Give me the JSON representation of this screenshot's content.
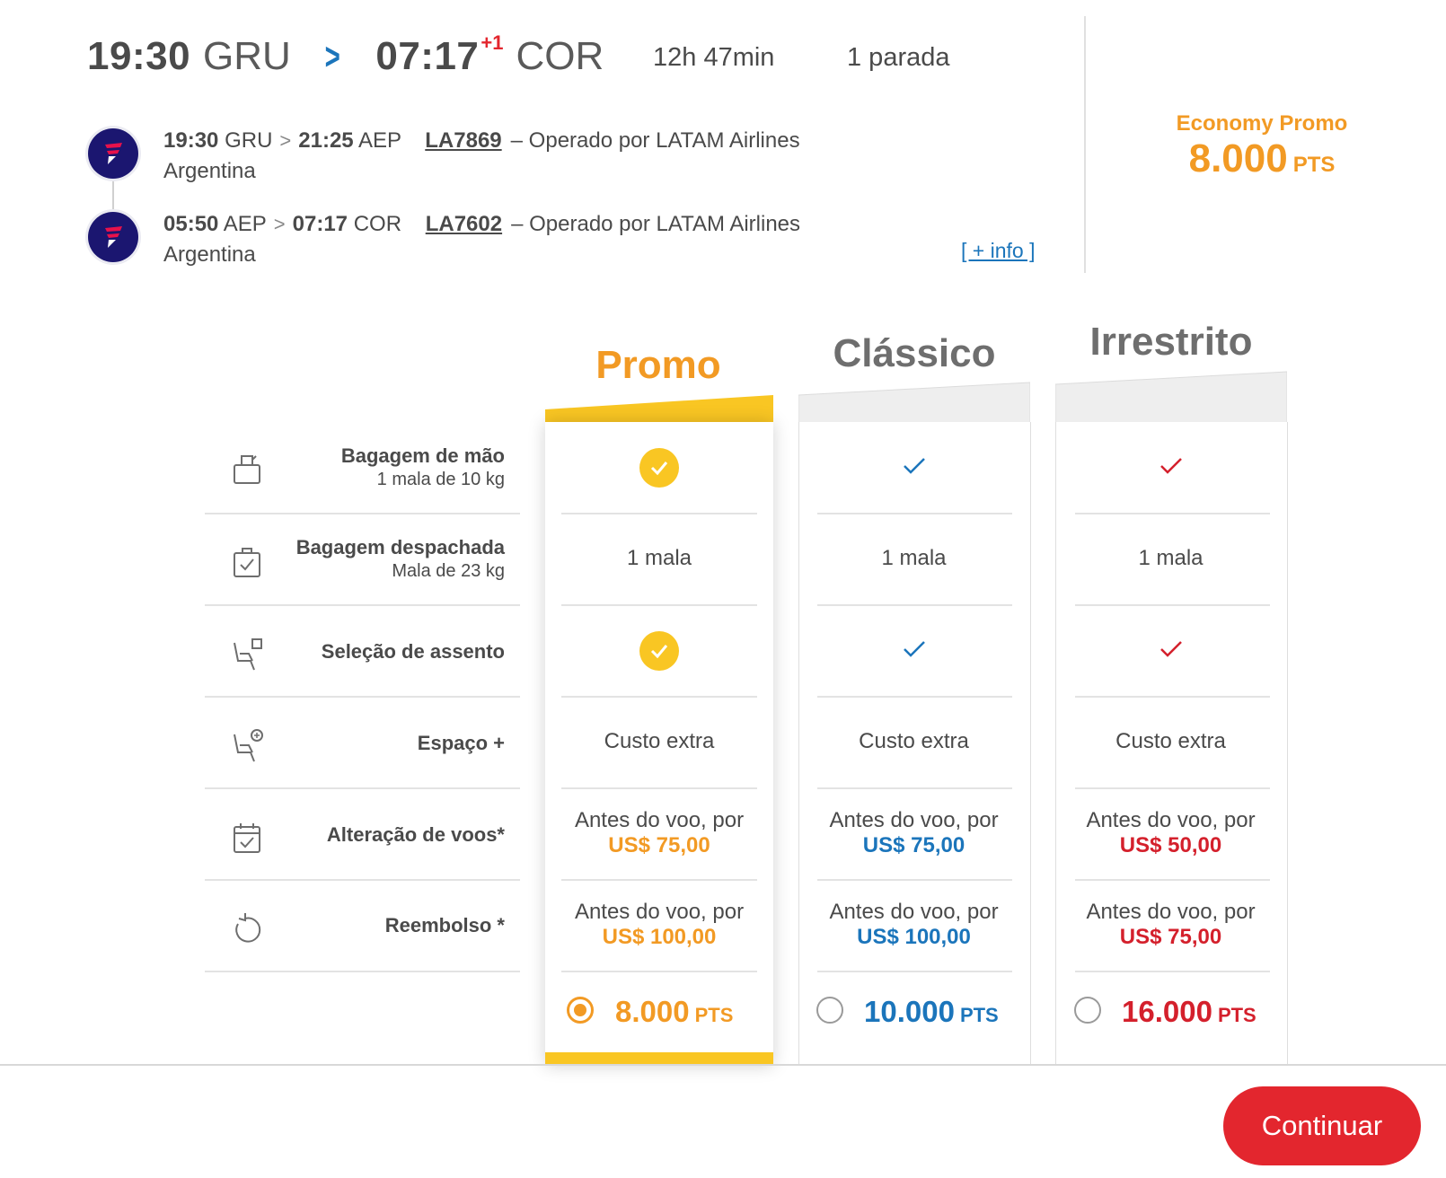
{
  "summary": {
    "dep_time": "19:30",
    "dep_code": "GRU",
    "arr_time": "07:17",
    "plus_day": "+1",
    "arr_code": "COR",
    "duration": "12h 47min",
    "stops": "1 parada"
  },
  "legs": [
    {
      "dep_time": "19:30",
      "dep_code": "GRU",
      "arr_time": "21:25",
      "arr_code": "AEP",
      "flight": "LA7869",
      "operator": "– Operado por LATAM Airlines",
      "operator_line2": "Argentina"
    },
    {
      "dep_time": "05:50",
      "dep_code": "AEP",
      "arr_time": "07:17",
      "arr_code": "COR",
      "flight": "LA7602",
      "operator": "– Operado por LATAM Airlines",
      "operator_line2": "Argentina"
    }
  ],
  "more_info": "[ + info ]",
  "selected_fare": {
    "label": "Economy Promo",
    "points": "8.000",
    "unit": "PTS"
  },
  "columns": [
    {
      "title": "Promo",
      "color": "#f29a24"
    },
    {
      "title": "Clássico",
      "color": "#1b75bb"
    },
    {
      "title": "Irrestrito",
      "color": "#d4202c"
    }
  ],
  "features": [
    {
      "title": "Bagagem de mão",
      "subtitle": "1 mala de 10 kg",
      "icon": "hand-baggage-icon"
    },
    {
      "title": "Bagagem despachada",
      "subtitle": "Mala de 23 kg",
      "icon": "checked-baggage-icon"
    },
    {
      "title": "Seleção de assento",
      "subtitle": "",
      "icon": "seat-selection-icon"
    },
    {
      "title": "Espaço +",
      "subtitle": "",
      "icon": "extra-space-seat-icon"
    },
    {
      "title": "Alteração de voos*",
      "subtitle": "",
      "icon": "calendar-change-icon"
    },
    {
      "title": "Reembolso *",
      "subtitle": "",
      "icon": "refund-icon"
    }
  ],
  "cells": {
    "checked_bag": [
      "1 mala",
      "1 mala",
      "1 mala"
    ],
    "extra_space": [
      "Custo extra",
      "Custo extra",
      "Custo extra"
    ],
    "change_text": [
      "Antes do voo, por",
      "Antes do voo, por",
      "Antes do voo, por"
    ],
    "change_price": [
      "US$ 75,00",
      "US$ 75,00",
      "US$ 50,00"
    ],
    "refund_text": [
      "Antes do voo, por",
      "Antes do voo, por",
      "Antes do voo, por"
    ],
    "refund_price": [
      "US$ 100,00",
      "US$ 100,00",
      "US$ 75,00"
    ]
  },
  "prices": [
    {
      "points": "8.000",
      "unit": "PTS",
      "selected": true
    },
    {
      "points": "10.000",
      "unit": "PTS",
      "selected": false
    },
    {
      "points": "16.000",
      "unit": "PTS",
      "selected": false
    }
  ],
  "continue_label": "Continuar"
}
